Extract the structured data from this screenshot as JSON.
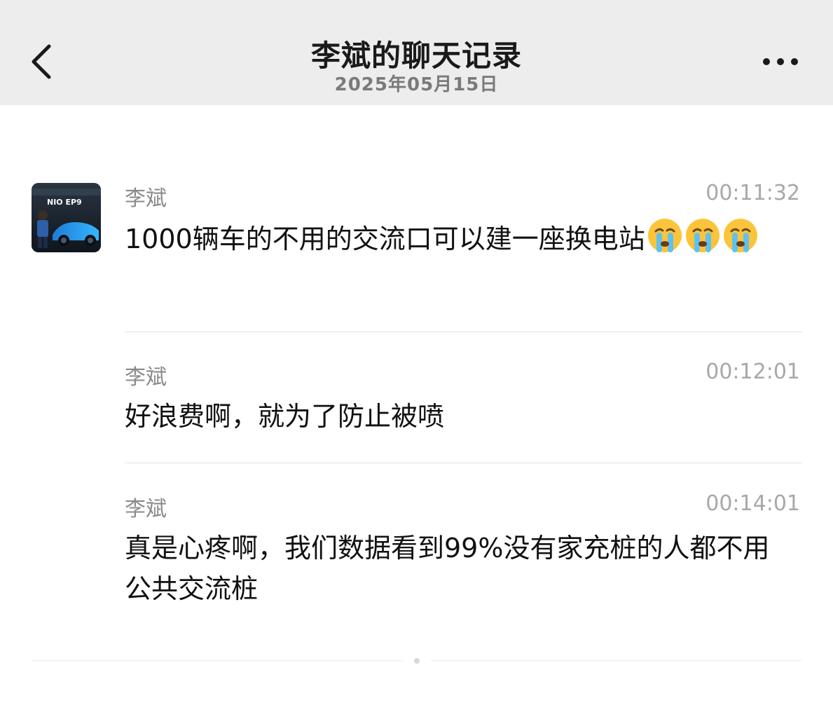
{
  "header": {
    "title": "李斌的聊天记录",
    "date": "2025年05月15日"
  },
  "avatar": {
    "badge": "NIO EP9"
  },
  "messages": [
    {
      "sender": "李斌",
      "time": "00:11:32",
      "text": "1000辆车的不用的交流口可以建一座换电站",
      "emojis": [
        "loudly-crying-face",
        "loudly-crying-face",
        "loudly-crying-face"
      ]
    },
    {
      "sender": "李斌",
      "time": "00:12:01",
      "text": "好浪费啊，就为了防止被喷"
    },
    {
      "sender": "李斌",
      "time": "00:14:01",
      "text": "真是心疼啊，我们数据看到99%没有家充桩的人都不用公共交流桩"
    }
  ],
  "colors": {
    "header_bg": "#ededed",
    "sender": "#8a8a8a",
    "time": "#a8a8a8",
    "text": "#111111"
  },
  "icons": [
    "back-chevron-icon",
    "more-dots-icon",
    "loudly-crying-face-emoji"
  ]
}
